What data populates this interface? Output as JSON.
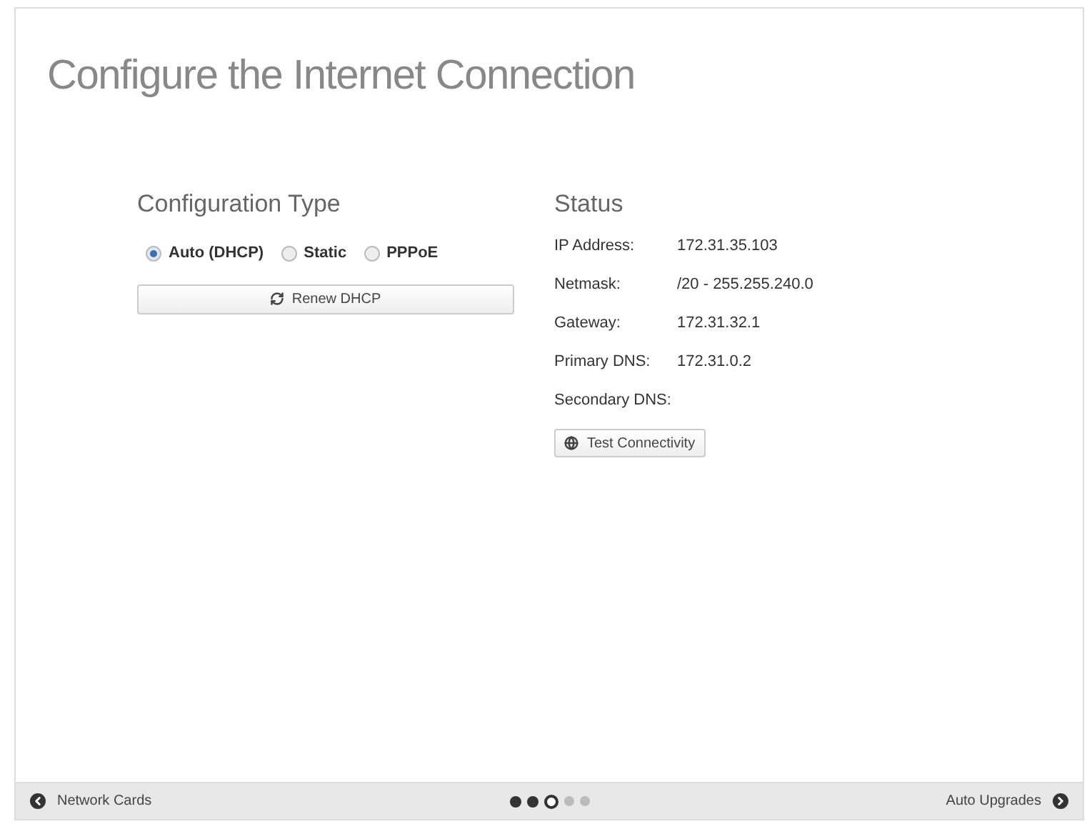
{
  "title": "Configure the Internet Connection",
  "config": {
    "heading": "Configuration Type",
    "options": [
      {
        "label": "Auto (DHCP)",
        "selected": true
      },
      {
        "label": "Static",
        "selected": false
      },
      {
        "label": "PPPoE",
        "selected": false
      }
    ],
    "button": "Renew DHCP"
  },
  "status": {
    "heading": "Status",
    "rows": [
      {
        "label": "IP Address:",
        "value": "172.31.35.103"
      },
      {
        "label": "Netmask:",
        "value": "/20 - 255.255.240.0"
      },
      {
        "label": "Gateway:",
        "value": "172.31.32.1"
      },
      {
        "label": "Primary DNS:",
        "value": "172.31.0.2"
      },
      {
        "label": "Secondary DNS:"
      }
    ],
    "button": "Test Connectivity"
  },
  "footer": {
    "back": "Network Cards",
    "next": "Auto Upgrades",
    "steps": [
      {
        "kind": "done"
      },
      {
        "kind": "done"
      },
      {
        "kind": "current"
      },
      {
        "kind": "upcoming"
      },
      {
        "kind": "upcoming"
      }
    ]
  }
}
